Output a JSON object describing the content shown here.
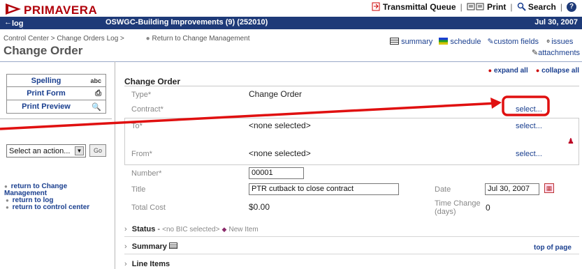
{
  "brand": {
    "logo_text": "PRIMAVERA"
  },
  "top_links": {
    "transmittal": "Transmittal Queue",
    "print": "Print",
    "search": "Search",
    "help": "?"
  },
  "navbar": {
    "logout": "log out",
    "project": "OSWGC-Building Improvements (9) (252010)",
    "date": "Jul 30, 2007"
  },
  "breadcrumb": {
    "path": "Control Center > Change Orders Log >",
    "return": "Return to Change Management"
  },
  "page": {
    "title": "Change Order"
  },
  "tools": {
    "summary": "summary",
    "schedule": "schedule",
    "custom_fields": "custom fields",
    "issues": "issues",
    "attachments": "attachments"
  },
  "expand": {
    "expand_all": "expand all",
    "collapse_all": "collapse all"
  },
  "sidebar": {
    "buttons": [
      {
        "label": "Spelling",
        "icon": "abc"
      },
      {
        "label": "Print Form",
        "icon": "printer-icon"
      },
      {
        "label": "Print Preview",
        "icon": "preview-icon"
      }
    ],
    "action_select": "Select an action...",
    "go": "Go",
    "links": [
      "return to Change Management",
      "return to log",
      "return to control center"
    ]
  },
  "form": {
    "section_title": "Change Order",
    "type_label": "Type*",
    "type_value": "Change Order",
    "contract_label": "Contract*",
    "select_label": "select...",
    "to_label": "To*",
    "to_value": "<none selected>",
    "from_label": "From*",
    "from_value": "<none selected>",
    "number_label": "Number*",
    "number_value": "00001",
    "title_label": "Title",
    "title_value": "PTR cutback to close contract",
    "date_label": "Date",
    "date_value": "Jul 30, 2007",
    "total_cost_label": "Total Cost",
    "total_cost_value": "$0.00",
    "time_change_label": "Time Change (days)",
    "time_change_value": "0"
  },
  "sections": {
    "status_label": "Status",
    "status_bic": "<no BIC selected>",
    "status_new": "New Item",
    "summary_label": "Summary",
    "line_items_label": "Line Items",
    "top_of_page": "top of page"
  },
  "colors": {
    "navbar": "#1e3a78",
    "link": "#1a3f8f",
    "callout": "#e01010",
    "brand": "#b0000a"
  }
}
